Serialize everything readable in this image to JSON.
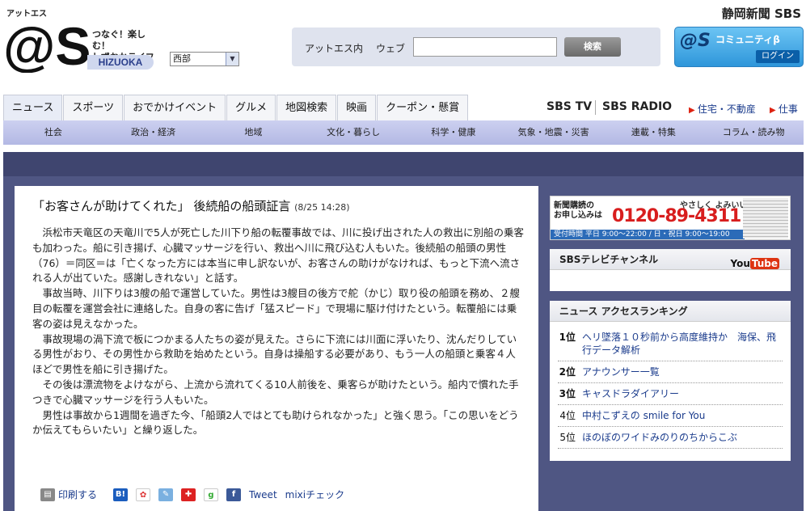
{
  "header": {
    "logo_text": "@S",
    "logo_small": "アットエス",
    "logo_sub": "HIZUOKA",
    "tagline_1": "つなぐ！楽しむ！",
    "tagline_2": "しずおかライフ",
    "region": "西部",
    "publisher": "静岡新聞 SBS",
    "search": {
      "label_site": "アットエス内",
      "label_web": "ウェブ",
      "input_value": "",
      "button": "検索"
    },
    "community": {
      "brand": "@S",
      "label": "コミュニティβ",
      "login": "ログイン"
    }
  },
  "nav": {
    "tabs": [
      "ニュース",
      "スポーツ",
      "おでかけイベント",
      "グルメ",
      "地図検索",
      "映画",
      "クーポン・懸賞"
    ],
    "sbs_tv": "SBS TV",
    "sbs_radio": "SBS RADIO",
    "link_housing": "住宅・不動産",
    "link_jobs": "仕事",
    "subnav": [
      "社会",
      "政治・経済",
      "地域",
      "文化・暮らし",
      "科学・健康",
      "気象・地震・災害",
      "連載・特集",
      "コラム・読み物"
    ]
  },
  "article": {
    "title": "「お客さんが助けてくれた」 後続船の船頭証言",
    "date": "(8/25 14:28)",
    "paragraphs": [
      "浜松市天竜区の天竜川で5人が死亡した川下り船の転覆事故では、川に投げ出された人の救出に別船の乗客も加わった。船に引き揚げ、心臓マッサージを行い、救出へ川に飛び込む人もいた。後続船の船頭の男性（76）＝同区＝は「亡くなった方には本当に申し訳ないが、お客さんの助けがなければ、もっと下流へ流される人が出ていた。感謝しきれない」と話す。",
      "事故当時、川下りは3艘の船で運営していた。男性は3艘目の後方で舵（かじ）取り役の船頭を務め、２艘目の転覆を運営会社に連絡した。自身の客に告げ「猛スピード」で現場に駆け付けたという。転覆船には乗客の姿は見えなかった。",
      "事故現場の渦下流で板につかまる人たちの姿が見えた。さらに下流には川面に浮いたり、沈んだりしている男性がおり、その男性から救助を始めたという。自身は操船する必要があり、もう一人の船頭と乗客４人ほどで男性を船に引き揚げた。",
      "その後は漂流物をよけながら、上流から流れてくる10人前後を、乗客らが助けたという。船内で慣れた手つきで心臓マッサージを行う人もいた。",
      "男性は事故から1週間を過ぎた今、「船頭2人ではとても助けられなかった」と強く思う。「この思いをどうか伝えてもらいたい」と繰り返した。"
    ],
    "share": {
      "print": "印刷する",
      "tweet": "Tweet",
      "mixi": "mixiチェック"
    }
  },
  "ad": {
    "line1": "新聞購読の",
    "line2": "お申し込みは",
    "phone": "0120-89-4311",
    "slogan": "やさしく よみいい",
    "hours": "受付時間 平日 9:00～22:00 / 日・祝日 9:00～19:00"
  },
  "sbs_channel": {
    "title": "SBSテレビチャンネル",
    "youtube_you": "You",
    "youtube_tube": "Tube"
  },
  "ranking": {
    "title": "ニュース アクセスランキング",
    "items": [
      {
        "rank": "1位",
        "text": "ヘリ墜落１０秒前から高度維持か　海保、飛行データ解析"
      },
      {
        "rank": "2位",
        "text": "アナウンサー一覧"
      },
      {
        "rank": "3位",
        "text": "キャスドラダイアリー"
      },
      {
        "rank": "4位",
        "text": "中村こずえの smile for You"
      },
      {
        "rank": "5位",
        "text": "ほのぼのワイドみのりのちからこぶ"
      }
    ]
  }
}
